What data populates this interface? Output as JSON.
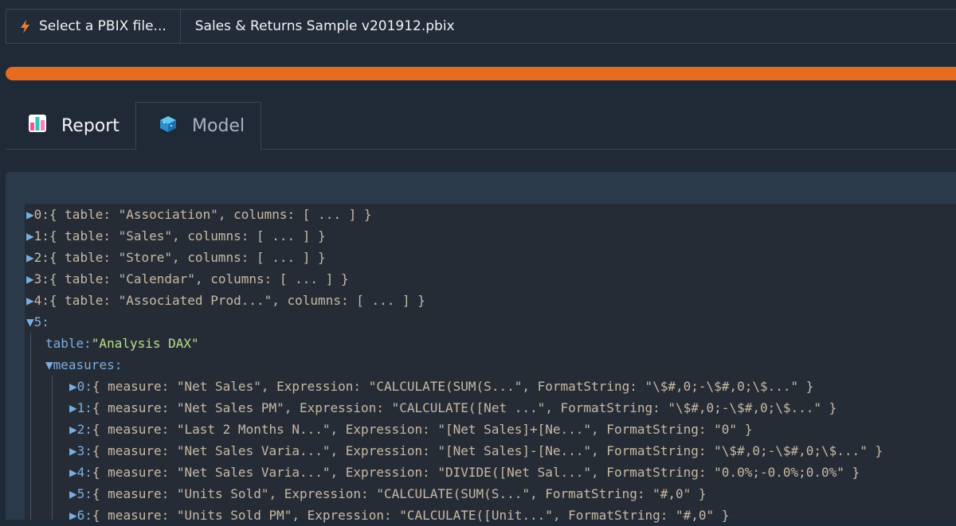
{
  "filebar": {
    "select_label": "Select a PBIX file...",
    "file_name": "Sales & Returns Sample v201912.pbix"
  },
  "progress": {
    "value_percent": 100,
    "color": "#e56b1f"
  },
  "tabs": [
    {
      "label": "Report",
      "icon": "bar-chart-icon",
      "active": false
    },
    {
      "label": "Model",
      "icon": "cube-icon",
      "active": true
    }
  ],
  "tree": {
    "tables": [
      {
        "key": "0:",
        "summary": "{ table: \"Association\", columns: [ ... ] }"
      },
      {
        "key": "1:",
        "summary": "{ table: \"Sales\", columns: [ ... ] }"
      },
      {
        "key": "2:",
        "summary": "{ table: \"Store\", columns: [ ... ] }"
      },
      {
        "key": "3:",
        "summary": "{ table: \"Calendar\", columns: [ ... ] }"
      },
      {
        "key": "4:",
        "summary": "{ table: \"Associated Prod...\", columns: [ ... ] }"
      }
    ],
    "expanded": {
      "key": "5:",
      "table_key": "table:",
      "table_value": "\"Analysis DAX\"",
      "measures_key": "measures:",
      "measures": [
        {
          "key": "0:",
          "summary": "{ measure: \"Net Sales\", Expression: \"CALCULATE(SUM(S...\", FormatString: \"\\$#,0;-\\$#,0;\\$...\" }"
        },
        {
          "key": "1:",
          "summary": "{ measure: \"Net Sales PM\", Expression: \"CALCULATE([Net ...\", FormatString: \"\\$#,0;-\\$#,0;\\$...\" }"
        },
        {
          "key": "2:",
          "summary": "{ measure: \"Last 2 Months N...\", Expression: \"[Net Sales]+[Ne...\", FormatString: \"0\" }"
        },
        {
          "key": "3:",
          "summary": "{ measure: \"Net Sales Varia...\", Expression: \"[Net Sales]-[Ne...\", FormatString: \"\\$#,0;-\\$#,0;\\$...\" }"
        },
        {
          "key": "4:",
          "summary": "{ measure: \"Net Sales Varia...\", Expression: \"DIVIDE([Net Sal...\", FormatString: \"0.0%;-0.0%;0.0%\" }"
        },
        {
          "key": "5:",
          "summary": "{ measure: \"Units Sold\", Expression: \"CALCULATE(SUM(S...\", FormatString: \"#,0\" }"
        },
        {
          "key": "6:",
          "summary": "{ measure: \"Units Sold PM\", Expression: \"CALCULATE([Unit...\", FormatString: \"#,0\" }"
        }
      ]
    }
  }
}
